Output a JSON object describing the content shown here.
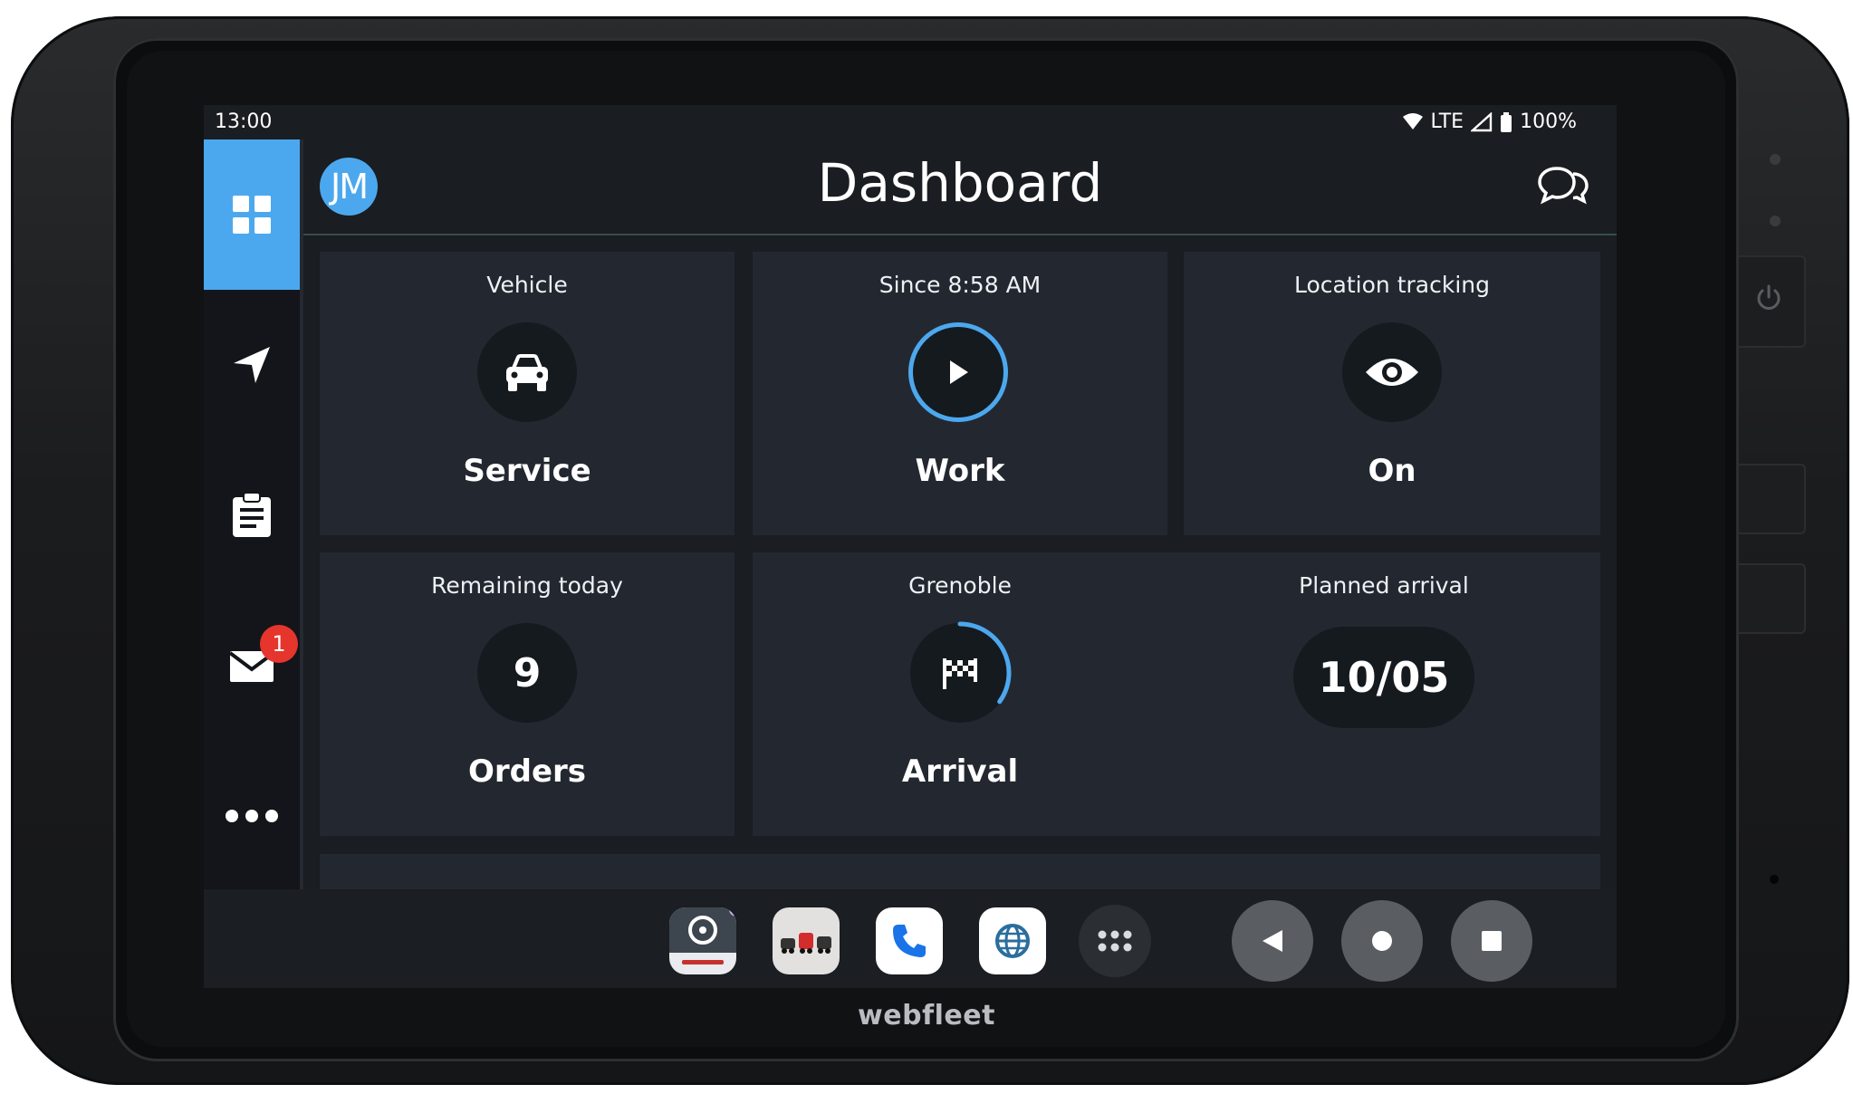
{
  "status": {
    "time": "13:00",
    "network": "LTE",
    "battery": "100%"
  },
  "header": {
    "avatar_initials": "JM",
    "title": "Dashboard"
  },
  "sidebar": {
    "items": [
      {
        "name": "dashboard",
        "icon": "grid-icon",
        "active": true
      },
      {
        "name": "navigation",
        "icon": "navigation-arrow-icon"
      },
      {
        "name": "orders",
        "icon": "clipboard-icon"
      },
      {
        "name": "messages",
        "icon": "mail-icon",
        "badge": "1"
      },
      {
        "name": "more",
        "icon": "more-dots-icon"
      }
    ]
  },
  "tiles": {
    "vehicle": {
      "caption": "Vehicle",
      "value": "Service",
      "icon": "car-icon"
    },
    "work": {
      "caption": "Since 8:58 AM",
      "value": "Work",
      "icon": "play-icon"
    },
    "location": {
      "caption": "Location tracking",
      "value": "On",
      "icon": "eye-icon"
    },
    "remaining": {
      "caption": "Remaining today",
      "count": "9",
      "value": "Orders"
    },
    "destination": {
      "caption": "Grenoble",
      "value": "Arrival",
      "icon": "checkered-flag-icon",
      "progress": 0.35
    },
    "planned": {
      "caption": "Planned arrival",
      "value": "10/05"
    }
  },
  "taskbar": {
    "apps": [
      "webfleet-driver-app-icon",
      "vehicles-app-icon",
      "phone-app-icon",
      "browser-app-icon",
      "app-drawer-icon"
    ],
    "nav": [
      "back-icon",
      "home-icon",
      "recents-icon"
    ]
  },
  "device": {
    "brand": "webfleet"
  },
  "colors": {
    "accent": "#4ca8ee",
    "badge": "#e5352c",
    "tile": "#232830",
    "screen": "#1a1d21"
  }
}
